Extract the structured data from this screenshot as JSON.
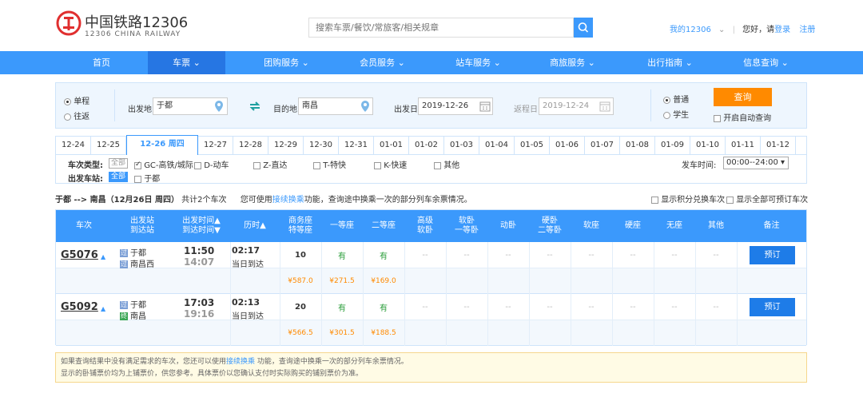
{
  "brand": {
    "name_cn": "中国铁路12306",
    "name_en": "12306 CHINA RAILWAY"
  },
  "search": {
    "placeholder": "搜索车票/餐饮/常旅客/相关规章"
  },
  "top": {
    "my12306": "我的12306",
    "greeting": "您好，请",
    "login": "登录",
    "register": "注册"
  },
  "nav": [
    "首页",
    "车票",
    "团购服务",
    "会员服务",
    "站车服务",
    "商旅服务",
    "出行指南",
    "信息查询"
  ],
  "query": {
    "one_way": "单程",
    "round_trip": "往返",
    "from_label": "出发地",
    "from_value": "于都",
    "to_label": "目的地",
    "to_value": "南昌",
    "depart_label": "出发日",
    "depart_value": "2019-12-26",
    "return_label": "返程日",
    "return_value": "2019-12-24",
    "normal": "普通",
    "student": "学生",
    "button": "查询",
    "auto_query": "开启自动查询"
  },
  "dates": [
    "12-24",
    "12-25",
    "12-26 周四",
    "12-27",
    "12-28",
    "12-29",
    "12-30",
    "12-31",
    "01-01",
    "01-02",
    "01-03",
    "01-04",
    "01-05",
    "01-06",
    "01-07",
    "01-08",
    "01-09",
    "01-10",
    "01-11",
    "01-12"
  ],
  "filters": {
    "train_type_label": "车次类型:",
    "all": "全部",
    "types": [
      "GC-高铁/城际",
      "D-动车",
      "Z-直达",
      "T-特快",
      "K-快速",
      "其他"
    ],
    "depart_station_label": "出发车站:",
    "station": "于都",
    "depart_time_label": "发车时间:",
    "depart_time_value": "00:00--24:00"
  },
  "summary": {
    "route": "于都 --> 南昌（12月26日 周四）",
    "count": "共计2个车次",
    "tip_prefix": "您可使用",
    "tip_link": "接续换乘",
    "tip_suffix": "功能，查询途中换乘一次的部分列车余票情况。",
    "opt1": "显示积分兑换车次",
    "opt2": "显示全部可预订车次"
  },
  "table": {
    "headers": [
      "车次",
      "出发站\n到达站",
      "出发时间▲\n到达时间▼",
      "历时▲",
      "商务座\n特等座",
      "一等座",
      "二等座",
      "高级\n软卧",
      "软卧\n一等卧",
      "动卧",
      "硬卧\n二等卧",
      "软座",
      "硬座",
      "无座",
      "其他",
      "备注"
    ],
    "trains": [
      {
        "no": "G5076",
        "from": "于都",
        "to": "南昌西",
        "dep": "11:50",
        "arr": "14:07",
        "dur": "02:17",
        "day": "当日到达",
        "seats": [
          "10",
          "有",
          "有",
          "--",
          "--",
          "--",
          "--",
          "--",
          "--",
          "--",
          "--"
        ],
        "prices": [
          "¥587.0",
          "¥271.5",
          "¥169.0"
        ],
        "book": "预订"
      },
      {
        "no": "G5092",
        "from": "于都",
        "to": "南昌",
        "dep": "17:03",
        "arr": "19:16",
        "dur": "02:13",
        "day": "当日到达",
        "seats": [
          "20",
          "有",
          "有",
          "--",
          "--",
          "--",
          "--",
          "--",
          "--",
          "--",
          "--"
        ],
        "prices": [
          "¥566.5",
          "¥301.5",
          "¥188.5"
        ],
        "book": "预订"
      }
    ]
  },
  "notice": {
    "line1_prefix": "如果查询结果中没有满足需求的车次，您还可以使用",
    "line1_link": "接续换乘",
    "line1_suffix": " 功能，查询途中换乘一次的部分列车余票情况。",
    "line2": "显示的卧铺票价均为上铺票价，供您参考。具体票价以您确认支付时实际购买的铺别票价为准。"
  },
  "colors": {
    "primary": "#3b99fc",
    "orange": "#ff8a00",
    "green": "#2a9d3a"
  }
}
